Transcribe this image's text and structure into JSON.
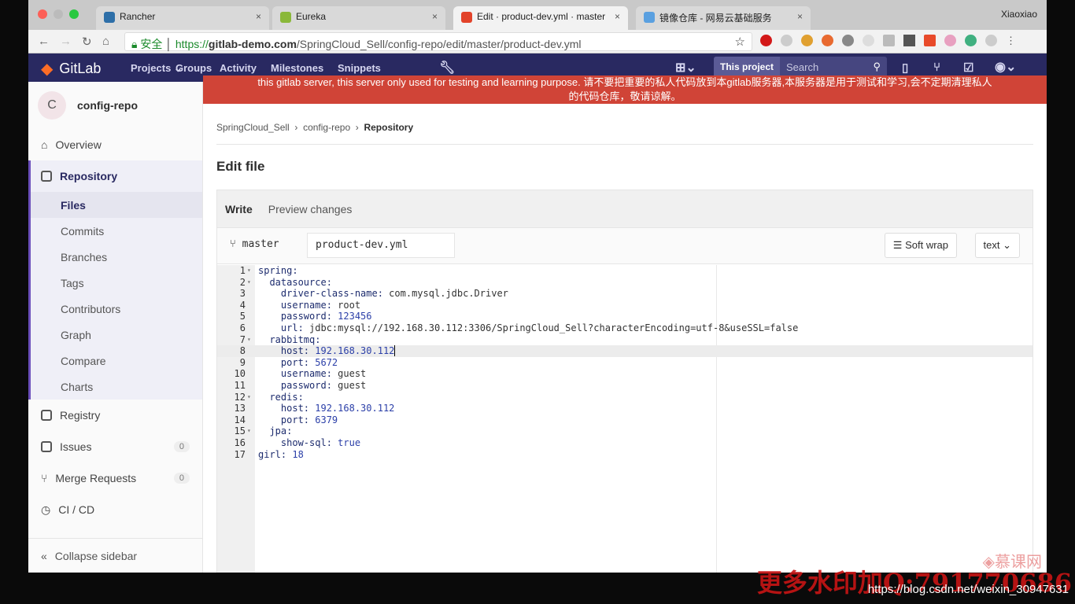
{
  "browser": {
    "tabs": [
      {
        "label": "Rancher",
        "color": "#2e6fa8"
      },
      {
        "label": "Eureka",
        "color": "#8ab83a"
      },
      {
        "label": "Edit · product-dev.yml · master",
        "color": "#e2432a"
      },
      {
        "label": "镜像仓库 - 网易云基础服务",
        "color": "#5aa0e0"
      }
    ],
    "user": "Xiaoxiao",
    "secure_label": "安全",
    "url_scheme": "https://",
    "url_host": "gitlab-demo.com",
    "url_path": "/SpringCloud_Sell/config-repo/edit/master/product-dev.yml"
  },
  "gitlab": {
    "brand": "GitLab",
    "nav": [
      "Projects",
      "Groups",
      "Activity",
      "Milestones",
      "Snippets"
    ],
    "search_scope": "This project",
    "search_placeholder": "Search",
    "nav_color": "#292961"
  },
  "sidebar": {
    "project_initial": "C",
    "project_name": "config-repo",
    "items": [
      {
        "label": "Overview",
        "icon": "home-icon"
      },
      {
        "label": "Repository",
        "icon": "book-icon"
      }
    ],
    "repo_sub": [
      "Files",
      "Commits",
      "Branches",
      "Tags",
      "Contributors",
      "Graph",
      "Compare",
      "Charts"
    ],
    "more": [
      {
        "label": "Registry",
        "icon": "box-icon"
      },
      {
        "label": "Issues",
        "icon": "issues-icon",
        "count": "0"
      },
      {
        "label": "Merge Requests",
        "icon": "merge-icon",
        "count": "0"
      },
      {
        "label": "CI / CD",
        "icon": "rocket-icon"
      }
    ],
    "collapse": "Collapse sidebar"
  },
  "banner": {
    "line1": "this gitlab server, this server only used for testing and learning purpose. 请不要把重要的私人代码放到本gitlab服务器,本服务器是用于测试和学习,会不定期清理私人",
    "line2": "的代码仓库，敬请谅解。",
    "color": "#d04437"
  },
  "breadcrumb": [
    "SpringCloud_Sell",
    "config-repo",
    "Repository"
  ],
  "page_title": "Edit file",
  "editor": {
    "tabs": [
      "Write",
      "Preview changes"
    ],
    "branch": "master",
    "file_name": "product-dev.yml",
    "soft_wrap": "Soft wrap",
    "mode": "text",
    "lines": [
      {
        "n": "1",
        "fold": true,
        "k": "spring:",
        "v": ""
      },
      {
        "n": "2",
        "fold": true,
        "k": "  datasource:",
        "v": ""
      },
      {
        "n": "3",
        "k": "    driver-class-name:",
        "v": " com.mysql.jdbc.Driver"
      },
      {
        "n": "4",
        "k": "    username:",
        "v": " root"
      },
      {
        "n": "5",
        "k": "    password:",
        "v": " 123456"
      },
      {
        "n": "6",
        "k": "    url:",
        "v": " jdbc:mysql://192.168.30.112:3306/SpringCloud_Sell?characterEncoding=utf-8&useSSL=false"
      },
      {
        "n": "7",
        "fold": true,
        "k": "  rabbitmq:",
        "v": ""
      },
      {
        "n": "8",
        "k": "    host:",
        "v": " 192.168.30.112",
        "current": true
      },
      {
        "n": "9",
        "k": "    port:",
        "v": " 5672"
      },
      {
        "n": "10",
        "k": "    username:",
        "v": " guest"
      },
      {
        "n": "11",
        "k": "    password:",
        "v": " guest"
      },
      {
        "n": "12",
        "fold": true,
        "k": "  redis:",
        "v": ""
      },
      {
        "n": "13",
        "k": "    host:",
        "v": " 192.168.30.112"
      },
      {
        "n": "14",
        "k": "    port:",
        "v": " 6379"
      },
      {
        "n": "15",
        "fold": true,
        "k": "  jpa:",
        "v": ""
      },
      {
        "n": "16",
        "k": "    show-sql:",
        "v": " true"
      },
      {
        "n": "17",
        "k": "girl:",
        "v": " 18"
      }
    ]
  },
  "watermark": {
    "logo": "慕课网",
    "overlay": "更多水印加Q:791770686",
    "url": "https://blog.csdn.net/weixin_30947631"
  }
}
